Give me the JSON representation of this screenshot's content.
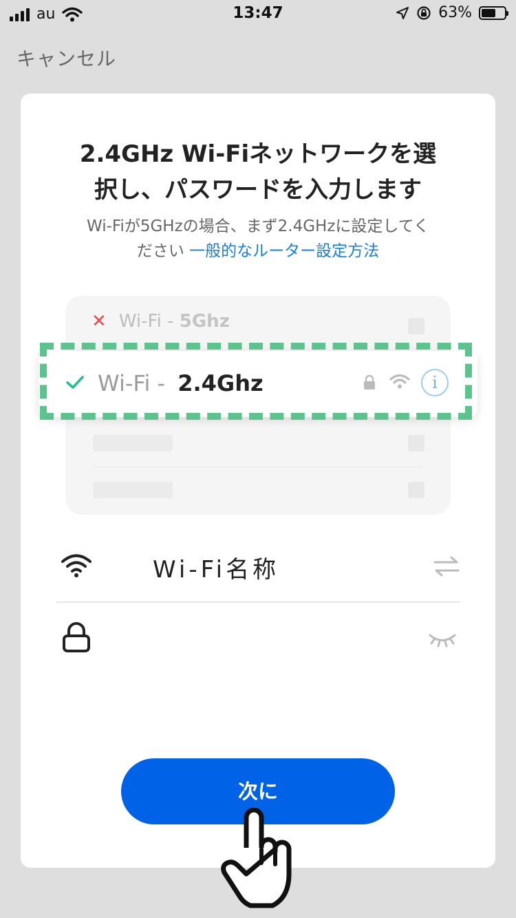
{
  "status_bar": {
    "carrier": "au",
    "time": "13:47",
    "battery_percent": "63%",
    "battery_level": 0.63
  },
  "nav": {
    "cancel_label": "キャンセル"
  },
  "main": {
    "title_line1": "2.4GHz Wi-Fiネットワークを選",
    "title_line2": "択し、パスワードを入力します",
    "subtitle_line1": "Wi-Fiが5GHzの場合、まず2.4GHzに設定してく",
    "subtitle_line2_prefix": "ださい",
    "subtitle_link": "一般的なルーター設定方法"
  },
  "illustration": {
    "row_5g_prefix": "Wi-Fi - ",
    "row_5g_band": "5Ghz",
    "row_24g_prefix": "Wi-Fi - ",
    "row_24g_band": "2.4Ghz",
    "info_glyph": "i",
    "colors": {
      "dashed_highlight": "#5cc28e",
      "check": "#1fbf8f",
      "cross": "#e84b4b"
    }
  },
  "form": {
    "wifi_name_value": "Wi-Fi名称",
    "password_value": ""
  },
  "next_button_label": "次に",
  "icons": [
    "signal-icon",
    "wifi-icon",
    "location-arrow-icon",
    "orientation-lock-icon",
    "battery-icon",
    "cross-icon",
    "check-icon",
    "lock-icon",
    "info-icon",
    "swap-icon",
    "eye-closed-icon",
    "pointing-hand-icon"
  ],
  "colors": {
    "accent": "#0062e6",
    "link": "#1a7ee0",
    "background": "#dedede"
  }
}
